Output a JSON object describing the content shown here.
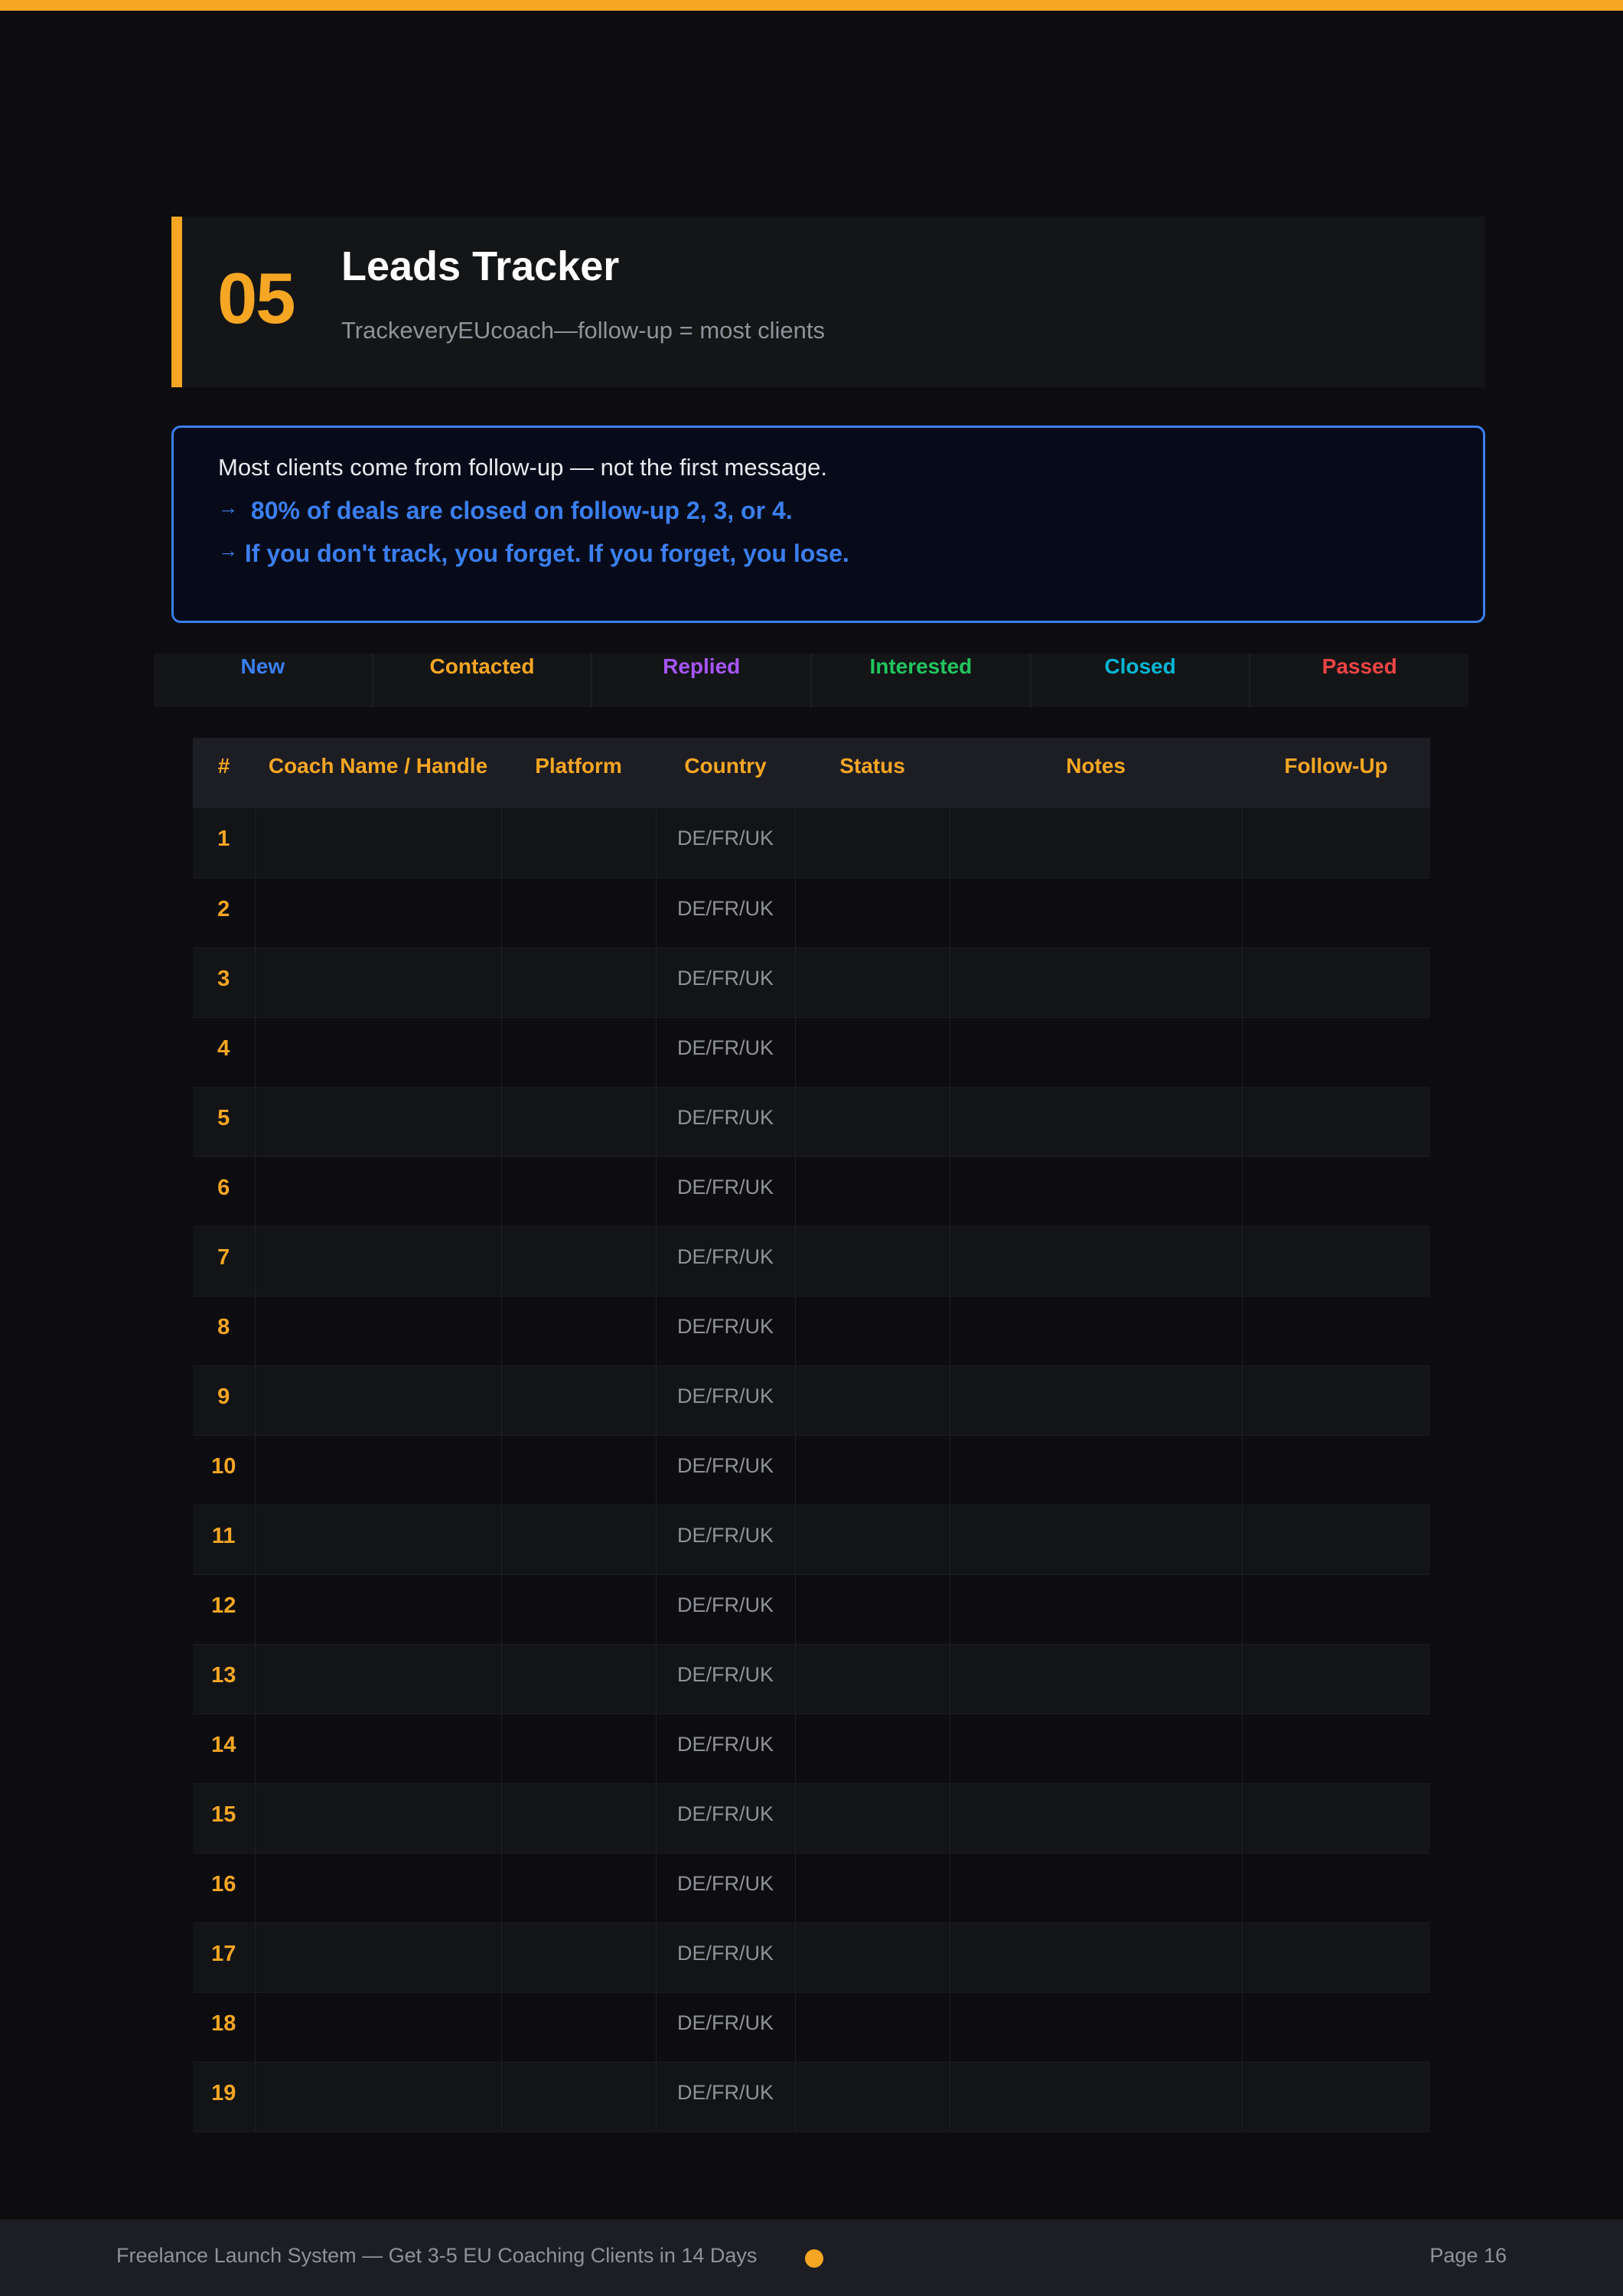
{
  "section": {
    "number": "05",
    "title": "Leads Tracker",
    "subtitle": "TrackeveryEUcoach—follow-up = most clients"
  },
  "callout": {
    "line1": "Most clients come from follow-up — not the first message.",
    "arrow": "→",
    "line2": "80% of deals are closed on follow-up 2, 3, or 4.",
    "line3": "If you don't track, you forget. If you forget, you lose."
  },
  "legend": [
    {
      "label": "New",
      "color": "#3b7ff0"
    },
    {
      "label": "Contacted",
      "color": "#f5a623"
    },
    {
      "label": "Replied",
      "color": "#a855f7"
    },
    {
      "label": "Interested",
      "color": "#22c55e"
    },
    {
      "label": "Closed",
      "color": "#06b6d4"
    },
    {
      "label": "Passed",
      "color": "#ef4444"
    }
  ],
  "table": {
    "headers": [
      "#",
      "Coach Name / Handle",
      "Platform",
      "Country",
      "Status",
      "Notes",
      "Follow-Up"
    ],
    "rows": [
      {
        "num": "1",
        "country": "DE/FR/UK"
      },
      {
        "num": "2",
        "country": "DE/FR/UK"
      },
      {
        "num": "3",
        "country": "DE/FR/UK"
      },
      {
        "num": "4",
        "country": "DE/FR/UK"
      },
      {
        "num": "5",
        "country": "DE/FR/UK"
      },
      {
        "num": "6",
        "country": "DE/FR/UK"
      },
      {
        "num": "7",
        "country": "DE/FR/UK"
      },
      {
        "num": "8",
        "country": "DE/FR/UK"
      },
      {
        "num": "9",
        "country": "DE/FR/UK"
      },
      {
        "num": "10",
        "country": "DE/FR/UK"
      },
      {
        "num": "11",
        "country": "DE/FR/UK"
      },
      {
        "num": "12",
        "country": "DE/FR/UK"
      },
      {
        "num": "13",
        "country": "DE/FR/UK"
      },
      {
        "num": "14",
        "country": "DE/FR/UK"
      },
      {
        "num": "15",
        "country": "DE/FR/UK"
      },
      {
        "num": "16",
        "country": "DE/FR/UK"
      },
      {
        "num": "17",
        "country": "DE/FR/UK"
      },
      {
        "num": "18",
        "country": "DE/FR/UK"
      },
      {
        "num": "19",
        "country": "DE/FR/UK"
      }
    ]
  },
  "footer": {
    "text": "Freelance Launch System — Get 3-5 EU Coaching Clients in 14 Days",
    "page": "Page 16"
  },
  "colors": {
    "accent": "#f5a623",
    "blue": "#3b7ff0",
    "background": "#0d0d10"
  }
}
